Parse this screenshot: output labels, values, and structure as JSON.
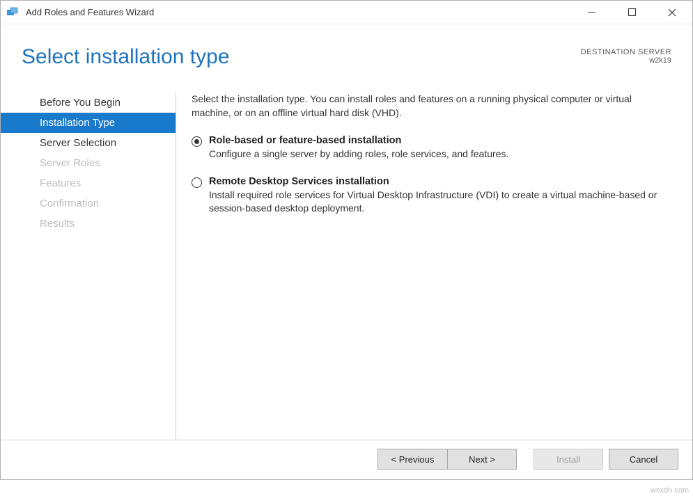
{
  "window": {
    "title": "Add Roles and Features Wizard"
  },
  "header": {
    "page_title": "Select installation type",
    "destination_label": "DESTINATION SERVER",
    "destination_server": "w2k19"
  },
  "sidebar": {
    "steps": [
      {
        "label": "Before You Begin",
        "state": "enabled"
      },
      {
        "label": "Installation Type",
        "state": "active"
      },
      {
        "label": "Server Selection",
        "state": "enabled"
      },
      {
        "label": "Server Roles",
        "state": "disabled"
      },
      {
        "label": "Features",
        "state": "disabled"
      },
      {
        "label": "Confirmation",
        "state": "disabled"
      },
      {
        "label": "Results",
        "state": "disabled"
      }
    ]
  },
  "main": {
    "intro": "Select the installation type. You can install roles and features on a running physical computer or virtual machine, or on an offline virtual hard disk (VHD).",
    "options": [
      {
        "title": "Role-based or feature-based installation",
        "description": "Configure a single server by adding roles, role services, and features.",
        "selected": true
      },
      {
        "title": "Remote Desktop Services installation",
        "description": "Install required role services for Virtual Desktop Infrastructure (VDI) to create a virtual machine-based or session-based desktop deployment.",
        "selected": false
      }
    ]
  },
  "footer": {
    "previous": "< Previous",
    "next": "Next >",
    "install": "Install",
    "cancel": "Cancel"
  },
  "watermark": "wsxdn.com"
}
